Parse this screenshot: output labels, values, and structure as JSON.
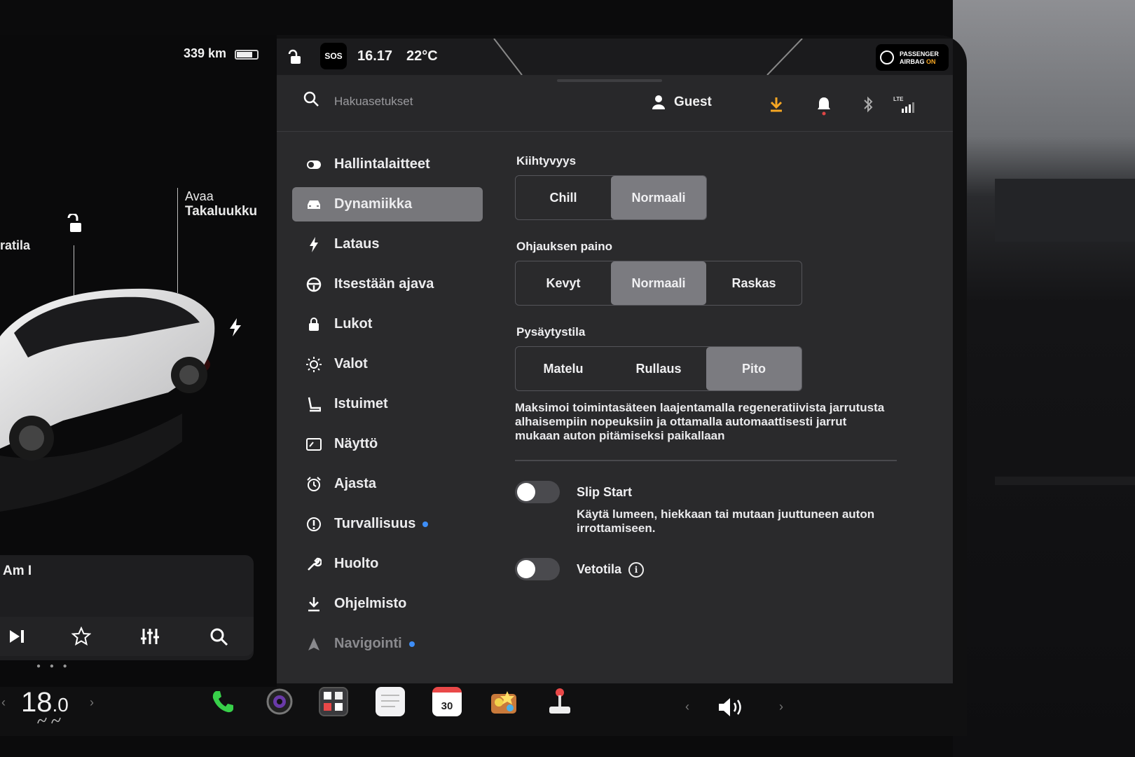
{
  "left_panel": {
    "range": "339 km",
    "label_trunk_top": "Avaa",
    "label_trunk_bottom": "Takaluukku",
    "label_partial": "ratila",
    "media_title": "Am I"
  },
  "status_bar": {
    "sos": "SOS",
    "time": "16.17",
    "temperature": "22°C",
    "airbag_line1": "PASSENGER",
    "airbag_line2": "AIRBAG",
    "airbag_state": "ON"
  },
  "top_bar": {
    "search_placeholder": "Hakuasetukset",
    "profile": "Guest",
    "lte": "LTE"
  },
  "nav": {
    "items": [
      {
        "label": "Hallintalaitteet",
        "icon": "toggle-icon"
      },
      {
        "label": "Dynamiikka",
        "icon": "car-icon",
        "active": true
      },
      {
        "label": "Lataus",
        "icon": "bolt-icon"
      },
      {
        "label": "Itsestään ajava",
        "icon": "steering-wheel-icon"
      },
      {
        "label": "Lukot",
        "icon": "lock-icon"
      },
      {
        "label": "Valot",
        "icon": "sun-icon"
      },
      {
        "label": "Istuimet",
        "icon": "seat-icon"
      },
      {
        "label": "Näyttö",
        "icon": "display-icon"
      },
      {
        "label": "Ajasta",
        "icon": "alarm-clock-icon"
      },
      {
        "label": "Turvallisuus",
        "icon": "alert-circle-icon",
        "badge": true
      },
      {
        "label": "Huolto",
        "icon": "wrench-icon"
      },
      {
        "label": "Ohjelmisto",
        "icon": "download-icon"
      },
      {
        "label": "Navigointi",
        "icon": "navigation-icon",
        "badge": true
      }
    ]
  },
  "content": {
    "acceleration": {
      "title": "Kiihtyvyys",
      "options": [
        "Chill",
        "Normaali"
      ],
      "selected": "Normaali"
    },
    "steering": {
      "title": "Ohjauksen paino",
      "options": [
        "Kevyt",
        "Normaali",
        "Raskas"
      ],
      "selected": "Normaali"
    },
    "stopping": {
      "title": "Pysäytystila",
      "options": [
        "Matelu",
        "Rullaus",
        "Pito"
      ],
      "selected": "Pito",
      "description": "Maksimoi toimintasäteen laajentamalla regeneratiivista jarrutusta alhaisempiin nopeuksiin ja ottamalla automaattisesti jarrut mukaan auton pitämiseksi paikallaan"
    },
    "slip_start": {
      "label": "Slip Start",
      "description": "Käytä lumeen, hiekkaan tai mutaan juuttuneen auton irrottamiseen.",
      "enabled": false
    },
    "tow_mode": {
      "label": "Vetotila",
      "enabled": false
    }
  },
  "dock": {
    "cabin_temp_whole": "18",
    "cabin_temp_decimal": ".0",
    "calendar_day": "30"
  },
  "colors": {
    "accent_orange": "#f5a623",
    "badge_blue": "#3e8ef7",
    "selected_segment": "#7b7b80",
    "panel_bg": "#2a2a2c"
  }
}
